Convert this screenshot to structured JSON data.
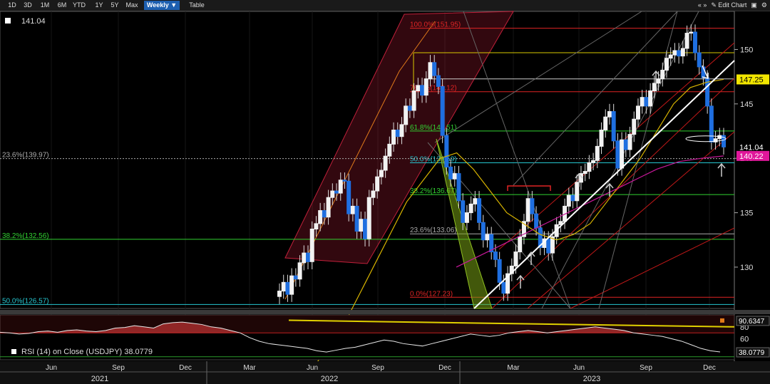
{
  "toolbar": {
    "ranges": [
      "1D",
      "3D",
      "1M",
      "6M",
      "YTD",
      "1Y",
      "5Y",
      "Max"
    ],
    "interval": "Weekly ▼",
    "table": "Table",
    "nav": "« »",
    "edit": "✎ Edit Chart",
    "icons": [
      "camera-icon",
      "gear-icon"
    ]
  },
  "chart_data": [
    {
      "type": "candlestick",
      "title": "",
      "last_value_label": "141.04",
      "ylim": [
        126.2,
        153.5
      ],
      "y_ticks": [
        130,
        135,
        140,
        145,
        150
      ],
      "x_ticks": [
        "Jun",
        "Sep",
        "Dec",
        "Mar",
        "Jun",
        "Sep",
        "Dec",
        "Mar",
        "Jun",
        "Sep",
        "Dec"
      ],
      "years": [
        "2021",
        "2022",
        "2023"
      ],
      "right_labels": [
        {
          "value": 147.25,
          "label": "147.25",
          "color": "#f2e600"
        },
        {
          "value": 141.04,
          "label": "141.04",
          "color": "#ffffff"
        },
        {
          "value": 140.22,
          "label": "140.22",
          "color": "#e0169a"
        }
      ],
      "fib_levels": [
        {
          "label": "100.0%(151.95)",
          "value": 151.95,
          "color": "#e02424"
        },
        {
          "label": "76.4%(146.12)",
          "value": 146.12,
          "color": "#e02424"
        },
        {
          "label": "61.8%(142.51)",
          "value": 142.51,
          "color": "#32d232"
        },
        {
          "label": "50.0%(139.59)",
          "value": 139.59,
          "color": "#26c6d0"
        },
        {
          "label": "38.2%(136.67)",
          "value": 136.67,
          "color": "#32d232"
        },
        {
          "label": "23.6%(133.06)",
          "value": 133.06,
          "color": "#aaaaaa"
        },
        {
          "label": "0.0%(127.23)",
          "value": 127.23,
          "color": "#e02424"
        }
      ],
      "left_fib_levels": [
        {
          "label": "23.6%(139.97)",
          "value": 139.97,
          "color": "#aaaaaa"
        },
        {
          "label": "38.2%(132.56)",
          "value": 132.56,
          "color": "#32d232"
        },
        {
          "label": "50.0%(126.57)",
          "value": 126.57,
          "color": "#26c6d0"
        }
      ],
      "candles_close": [
        127.8,
        128.6,
        127.5,
        129.2,
        128.9,
        130.4,
        131.3,
        130.5,
        133.5,
        134.0,
        135.2,
        134.6,
        136.4,
        137.0,
        136.8,
        138.0,
        137.9,
        134.9,
        135.6,
        133.3,
        134.4,
        132.6,
        136.4,
        137.0,
        138.3,
        138.9,
        140.2,
        141.3,
        142.6,
        142.0,
        143.1,
        144.8,
        144.4,
        146.2,
        146.7,
        145.8,
        147.3,
        148.8,
        147.6,
        146.6,
        142.1,
        139.2,
        138.1,
        138.6,
        136.1,
        134.1,
        135.0,
        135.8,
        136.3,
        134.1,
        132.5,
        133.0,
        131.4,
        130.7,
        128.6,
        127.6,
        129.4,
        130.1,
        131.4,
        132.8,
        134.2,
        136.3,
        134.9,
        133.6,
        131.8,
        132.6,
        131.3,
        132.8,
        133.9,
        134.2,
        135.6,
        136.6,
        136.1,
        137.8,
        138.6,
        138.8,
        139.6,
        139.8,
        141.1,
        142.6,
        143.8,
        144.3,
        141.6,
        139.1,
        141.7,
        140.8,
        142.2,
        143.6,
        144.8,
        145.6,
        144.8,
        146.2,
        146.9,
        147.3,
        148.1,
        149.2,
        149.5,
        149.9,
        149.4,
        150.1,
        151.5,
        151.6,
        149.7,
        148.4,
        147.4,
        144.8,
        141.5,
        141.8,
        142.1,
        141.04
      ],
      "ma_yellow_values": [
        120,
        122,
        124,
        127,
        130,
        133,
        136,
        138,
        140,
        140.5,
        139,
        137,
        135,
        134,
        133,
        132.5,
        133,
        134,
        136,
        138,
        140,
        142.5,
        145,
        146.5,
        147,
        147.25
      ],
      "ma_magenta_values": [
        130,
        131,
        132,
        133,
        134,
        135,
        136,
        137,
        138,
        139,
        139.7,
        140,
        140.22
      ]
    },
    {
      "type": "line",
      "title": "",
      "legend": "RSI (14)  on Close (USDJPY) 38.0779",
      "ylim": [
        25,
        100
      ],
      "y_ticks": [
        60,
        80
      ],
      "right_labels": [
        {
          "value": 90.6347,
          "label": "90.6347"
        },
        {
          "value": 38.0779,
          "label": "38.0779"
        }
      ],
      "values": [
        71,
        70,
        68,
        69,
        72,
        73,
        71,
        74,
        75,
        73,
        72,
        74,
        78,
        79,
        82,
        80,
        78,
        85,
        87,
        88,
        86,
        84,
        80,
        78,
        74,
        70,
        62,
        56,
        52,
        50,
        48,
        46,
        44,
        40,
        38,
        41,
        44,
        46,
        50,
        54,
        58,
        56,
        52,
        50,
        48,
        52,
        56,
        60,
        64,
        68,
        66,
        64,
        66,
        70,
        72,
        74,
        72,
        70,
        72,
        74,
        76,
        78,
        80,
        78,
        76,
        74,
        70,
        68,
        66,
        64,
        60,
        56,
        50,
        44,
        40,
        38.08
      ]
    }
  ]
}
